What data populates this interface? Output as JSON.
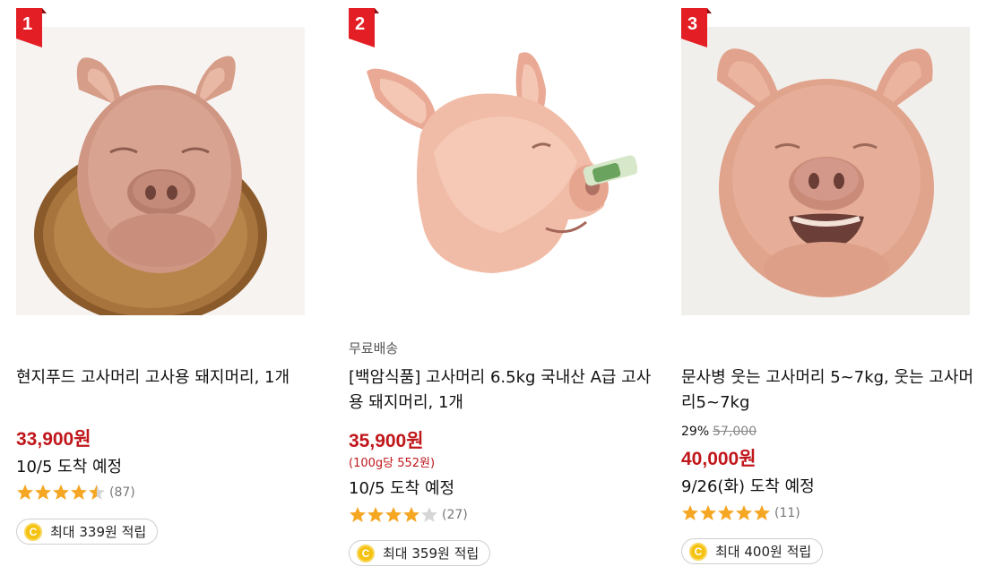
{
  "products": [
    {
      "rank": "1",
      "free_shipping": "",
      "title": "현지푸드 고사머리 고사용 돼지머리, 1개",
      "discount_rate": "",
      "original_price": "",
      "price": "33,900원",
      "unit_price": "",
      "delivery": "10/5 도착 예정",
      "rating_value": 4.5,
      "rating_count": "(87)",
      "reward": "최대 339원 적립"
    },
    {
      "rank": "2",
      "free_shipping": "무료배송",
      "title": "[백암식품] 고사머리 6.5kg 국내산 A급 고사용 돼지머리, 1개",
      "discount_rate": "",
      "original_price": "",
      "price": "35,900원",
      "unit_price": "(100g당 552원)",
      "delivery": "10/5 도착 예정",
      "rating_value": 4,
      "rating_count": "(27)",
      "reward": "최대 359원 적립"
    },
    {
      "rank": "3",
      "free_shipping": "",
      "title": "문사병 웃는 고사머리 5~7kg, 웃는 고사머리5~7kg",
      "discount_rate": "29%",
      "original_price": "57,000",
      "price": "40,000원",
      "unit_price": "",
      "delivery": "9/26(화) 도착 예정",
      "rating_value": 5,
      "rating_count": "(11)",
      "reward": "최대 400원 적립"
    }
  ],
  "coin_symbol": "C",
  "colors": {
    "rank_badge": "#e31e24",
    "price": "#c0171b",
    "star_filled": "#f5a623",
    "star_empty": "#d6d6d6",
    "coin": "#f5c211"
  },
  "icons": {
    "rank": "ribbon-flag-icon",
    "star": "star-icon",
    "coin": "coin-icon"
  }
}
